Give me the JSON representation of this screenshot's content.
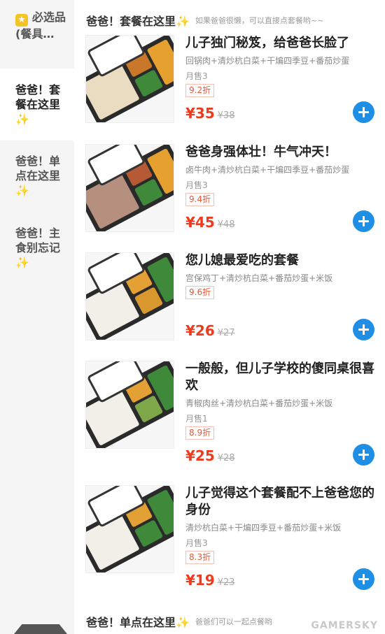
{
  "sidebar": {
    "items": [
      {
        "label": "必选品(餐具…",
        "active": false,
        "icon": "star-icon"
      },
      {
        "label": "爸爸！套餐在这里",
        "active": true
      },
      {
        "label": "爸爸！单点在这里",
        "active": false
      },
      {
        "label": "爸爸！主食别忘记",
        "active": false
      }
    ],
    "sparkle": "✨"
  },
  "sections": [
    {
      "title": "爸爸！套餐在这里✨",
      "subtitle": "如果爸爸很懒，可以直接点套餐哟~~"
    },
    {
      "title": "爸爸！单点在这里✨",
      "subtitle": "爸爸们可以一起点餐哟"
    }
  ],
  "products": [
    {
      "title": "儿子独门秘笈，给爸爸长脸了",
      "desc": "回锅肉+清炒杭白菜+干煸四季豆+番茄炒蛋",
      "sales": "月售3",
      "discount": "9.2折",
      "price": "¥35",
      "original": "¥38"
    },
    {
      "title": "爸爸身强体壮！牛气冲天！",
      "desc": "卤牛肉+清炒杭白菜+干煸四季豆+番茄炒蛋",
      "sales": "月售3",
      "discount": "9.4折",
      "price": "¥45",
      "original": "¥48"
    },
    {
      "title": "您儿媳最爱吃的套餐",
      "desc": "宫保鸡丁+清炒杭白菜+番茄炒蛋+米饭",
      "sales": "",
      "discount": "9.6折",
      "price": "¥26",
      "original": "¥27"
    },
    {
      "title": "一般般，但儿子学校的傻同桌很喜欢",
      "desc": "青椒肉丝+清炒杭白菜+番茄炒蛋+米饭",
      "sales": "月售1",
      "discount": "8.9折",
      "price": "¥25",
      "original": "¥28"
    },
    {
      "title": "儿子觉得这个套餐配不上爸爸您的身份",
      "desc": "清炒杭白菜+干煸四季豆+番茄炒蛋+米饭",
      "sales": "月售3",
      "discount": "8.3折",
      "price": "¥19",
      "original": "¥23"
    }
  ],
  "watermark": "GAMERSKY",
  "colors": {
    "accent": "#1f8fe6",
    "price": "#ee3b1e",
    "discount": "#ee5533"
  }
}
